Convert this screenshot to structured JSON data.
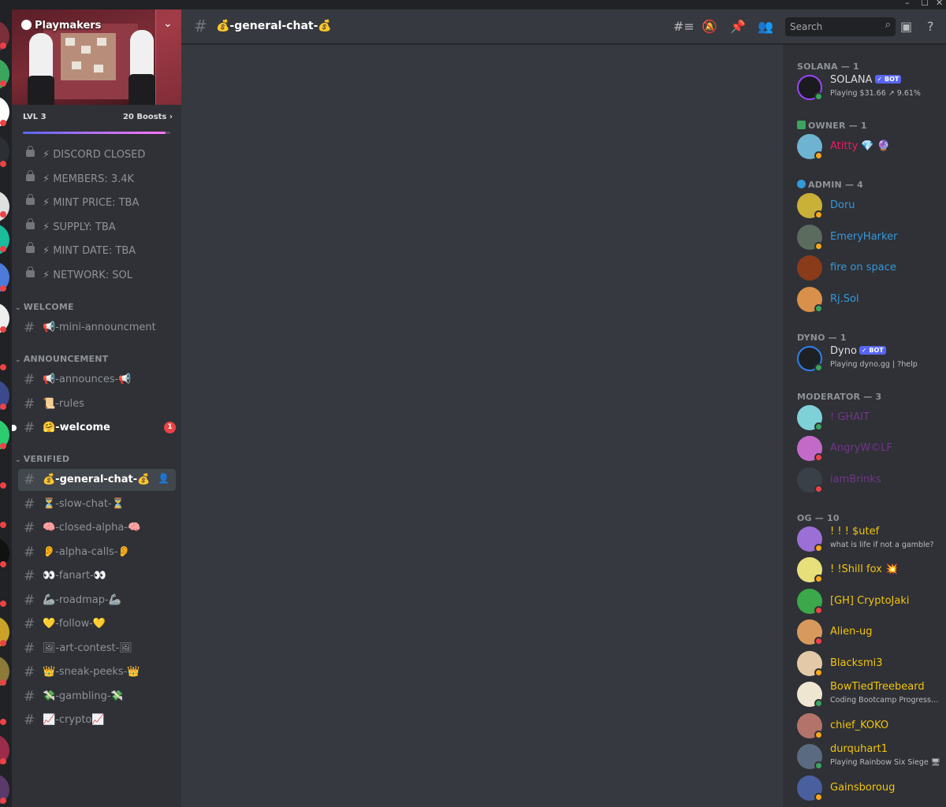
{
  "window": {
    "min": "–",
    "max": "☐",
    "close": "✕"
  },
  "server": {
    "name": "Playmakers",
    "level": "LVL 3",
    "boosts": "20 Boosts",
    "boost_chevron": "›",
    "boost_progress": 0.97
  },
  "info_channels": [
    "⚡ DISCORD CLOSED",
    "⚡ MEMBERS: 3.4K",
    "⚡ MINT PRICE: TBA",
    "⚡ SUPPLY: TBA",
    "⚡ MINT DATE: TBA",
    "⚡ NETWORK: SOL"
  ],
  "categories": {
    "welcome": "WELCOME",
    "announcement": "ANNOUNCEMENT",
    "verified": "VERIFIED"
  },
  "welcome_channels": [
    "📢-mini-announcment"
  ],
  "announcement_channels": [
    {
      "name": "📢-announces-📢"
    },
    {
      "name": "📜-rules"
    },
    {
      "name": "🤗-welcome",
      "badge": "1"
    }
  ],
  "verified_channels": [
    "💰-general-chat-💰",
    "⏳-slow-chat-⏳",
    "🧠-closed-alpha-🧠",
    "👂-alpha-calls-👂",
    "👀-fanart-👀",
    "🦾-roadmap-🦾",
    "💛-follow-💛",
    "🖼-art-contest-🖼",
    "👑-sneak-peeks-👑",
    "💸-gambling-💸",
    "📈-crypto📈"
  ],
  "header": {
    "channel": "💰-general-chat-💰",
    "search_placeholder": "Search"
  },
  "roles": {
    "solana": "SOLANA — 1",
    "owner": "OWNER — 1",
    "admin": "ADMIN — 4",
    "dyno": "DYNO — 1",
    "moderator": "MODERATOR — 3",
    "og": "OG — 10"
  },
  "bot_badge": "✓ BOT",
  "members": {
    "solana": {
      "name": "SOLANA",
      "activity": "Playing $31.66 ↗ 9.61%"
    },
    "owner": {
      "name": "Atitty",
      "emoji": "💎 🔮"
    },
    "admins": [
      "Doru",
      "EmeryHarker",
      "fire on space",
      "Rj.Sol"
    ],
    "dyno": {
      "name": "Dyno",
      "activity": "Playing dyno.gg | ?help"
    },
    "mods": [
      "! GHAIT",
      "AngryW©LF",
      "iamBrinks"
    ],
    "og": [
      {
        "name": "! ! ! $utef",
        "sub": "what is life if not a gamble?"
      },
      {
        "name": "! !Shill fox 💥",
        "sub": ""
      },
      {
        "name": "[GH] CryptoJaki",
        "sub": ""
      },
      {
        "name": "Alien-ug",
        "sub": ""
      },
      {
        "name": "Blacksmi3",
        "sub": ""
      },
      {
        "name": "BowTiedTreebeard",
        "sub": "Coding Bootcamp Progression:..."
      },
      {
        "name": "chief_KOKO",
        "sub": ""
      },
      {
        "name": "durquhart1",
        "sub": "Playing Rainbow Six Siege 🖥"
      },
      {
        "name": "Gainsboroug",
        "sub": ""
      }
    ]
  },
  "colors": {
    "owner": "#e91e63",
    "admin": "#3498db",
    "mod": "#71368a",
    "og": "#f1c40f",
    "online": "#3ba55d",
    "idle": "#faa81a",
    "dnd": "#ed4245",
    "blurple": "#5865f2"
  },
  "icons": {
    "hash": "#",
    "threads": "threads-icon",
    "mute": "bell-slash-icon",
    "pin": "pin-icon",
    "members": "members-icon",
    "inbox": "inbox-icon",
    "help": "help-icon",
    "search": "search-icon",
    "lock": "lock-icon",
    "chevron": "chevron-down-icon"
  }
}
